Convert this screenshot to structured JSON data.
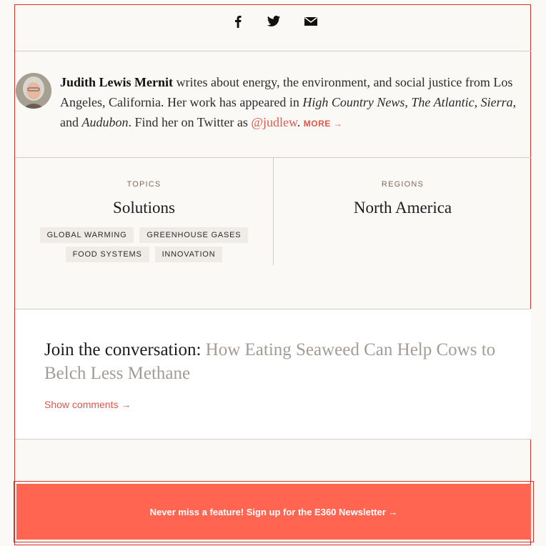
{
  "share": {
    "icons": [
      "facebook-icon",
      "twitter-icon",
      "email-icon"
    ]
  },
  "author": {
    "avatar_icon": "author-photo",
    "name": "Judith Lewis Mernit",
    "bio_part1": " writes about energy, the environment, and social justice from Los Angeles, California. Her work has appeared in ",
    "pub1": "High Country News",
    "sep1": ", ",
    "pub2": "The Atlantic",
    "sep2": ", ",
    "pub3": "Sierra",
    "sep3": ", and ",
    "pub4": "Audubon",
    "bio_part2": ". Find her on Twitter as ",
    "twitter": "@judlew",
    "bio_part3": ". ",
    "more_label": "MORE →"
  },
  "topics": {
    "label": "TOPICS",
    "title": "Solutions",
    "tags": [
      "GLOBAL WARMING",
      "GREENHOUSE GASES",
      "FOOD SYSTEMS",
      "INNOVATION"
    ]
  },
  "regions": {
    "label": "REGIONS",
    "title": "North America"
  },
  "conversation": {
    "prefix": "Join the conversation: ",
    "article_title": "How Eating Seaweed Can Help Cows to Belch Less Methane",
    "show_comments": "Show comments →"
  },
  "newsletter": {
    "label": "Never miss a feature! Sign up for the E360 Newsletter →"
  },
  "colors": {
    "accent": "#e2564b",
    "newsletter_bg": "#ff6551",
    "page_bg": "#fbf9f6"
  }
}
